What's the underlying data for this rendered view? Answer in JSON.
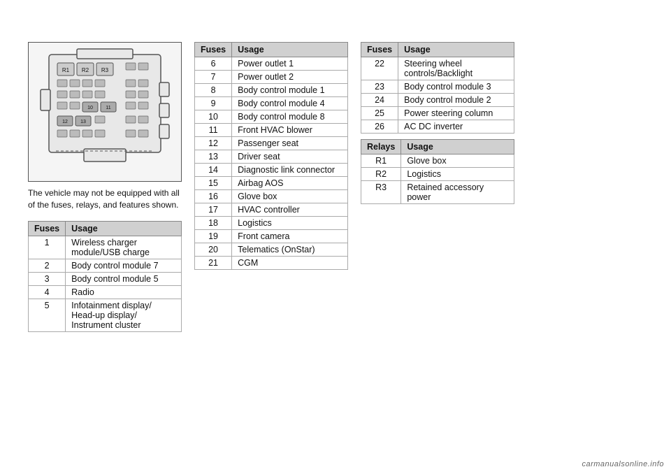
{
  "caption": "The vehicle may not be equipped with all of the fuses, relays, and features shown.",
  "left_table": {
    "headers": [
      "Fuses",
      "Usage"
    ],
    "rows": [
      [
        "1",
        "Wireless charger module/USB charge"
      ],
      [
        "2",
        "Body control module 7"
      ],
      [
        "3",
        "Body control module 5"
      ],
      [
        "4",
        "Radio"
      ],
      [
        "5",
        "Infotainment display/ Head-up display/ Instrument cluster"
      ]
    ]
  },
  "mid_table": {
    "headers": [
      "Fuses",
      "Usage"
    ],
    "rows": [
      [
        "6",
        "Power outlet 1"
      ],
      [
        "7",
        "Power outlet 2"
      ],
      [
        "8",
        "Body control module 1"
      ],
      [
        "9",
        "Body control module 4"
      ],
      [
        "10",
        "Body control module 8"
      ],
      [
        "11",
        "Front HVAC blower"
      ],
      [
        "12",
        "Passenger seat"
      ],
      [
        "13",
        "Driver seat"
      ],
      [
        "14",
        "Diagnostic link connector"
      ],
      [
        "15",
        "Airbag AOS"
      ],
      [
        "16",
        "Glove box"
      ],
      [
        "17",
        "HVAC controller"
      ],
      [
        "18",
        "Logistics"
      ],
      [
        "19",
        "Front camera"
      ],
      [
        "20",
        "Telematics (OnStar)"
      ],
      [
        "21",
        "CGM"
      ]
    ]
  },
  "right_fuse_table": {
    "headers": [
      "Fuses",
      "Usage"
    ],
    "rows": [
      [
        "22",
        "Steering wheel controls/Backlight"
      ],
      [
        "23",
        "Body control module 3"
      ],
      [
        "24",
        "Body control module 2"
      ],
      [
        "25",
        "Power steering column"
      ],
      [
        "26",
        "AC DC inverter"
      ]
    ]
  },
  "right_relay_table": {
    "headers": [
      "Relays",
      "Usage"
    ],
    "rows": [
      [
        "R1",
        "Glove box"
      ],
      [
        "R2",
        "Logistics"
      ],
      [
        "R3",
        "Retained accessory power"
      ]
    ]
  },
  "watermark": "carmanualsonline.info"
}
